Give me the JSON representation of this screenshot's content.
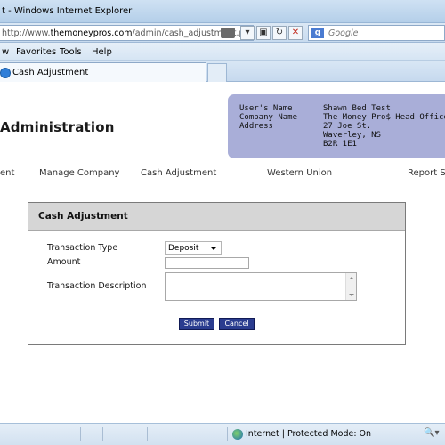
{
  "browser": {
    "title": "t - Windows Internet Explorer",
    "url_prefix": "http://www.",
    "url_domain": "themoneypros.com",
    "url_path": "/admin/cash_adjustment.ph",
    "search_placeholder": "Google",
    "search_logo": "g-logo-icon",
    "menu": [
      "w",
      "Favorites",
      "Tools",
      "Help"
    ],
    "tab_label": "Cash Adjustment",
    "status_text": "Internet | Protected Mode: On"
  },
  "page": {
    "app_title": "Administration",
    "user_info": {
      "name_label": "User's Name",
      "company_label": "Company Name",
      "address_label": "Address",
      "name_value": "Shawn Bed Test",
      "company_value": "The Money Pro$ Head Office",
      "address_lines": [
        "27 Joe St.",
        "Waverley, NS",
        "B2R 1E1"
      ]
    },
    "nav": [
      "ent",
      "Manage Company",
      "Cash Adjustment",
      "Western Union",
      "Report Se"
    ],
    "form": {
      "heading": "Cash Adjustment",
      "type_label": "Transaction Type",
      "type_value": "Deposit",
      "amount_label": "Amount",
      "amount_value": "",
      "desc_label": "Transaction Description",
      "desc_value": "",
      "submit_label": "Submit",
      "cancel_label": "Cancel"
    }
  },
  "colors": {
    "user_box": "#a9aed8",
    "button": "#2a3c8f",
    "panel_header": "#d6d6d6"
  }
}
